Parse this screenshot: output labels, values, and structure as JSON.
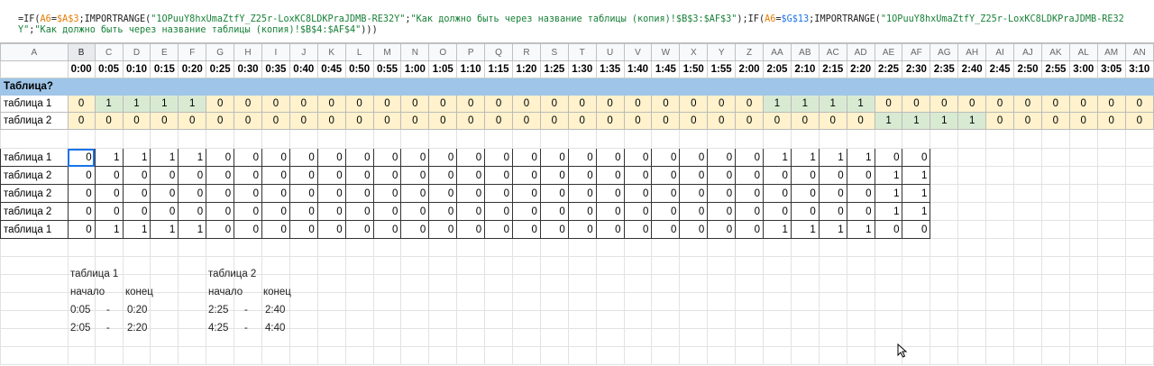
{
  "formula": {
    "p1": "=IF(",
    "r1": "A6",
    "p2": "=",
    "r2": "$A$3",
    "p3": ";IMPORTRANGE(",
    "s1": "\"1OPuuY8hxUmaZtfY_Z25r-LoxKC8LDKPraJDMB-RE32Y\"",
    "p4": ";",
    "s2": "\"Как должно быть через название таблицы (копия)!$B$3:$AF$3\"",
    "p5": ");IF(",
    "r3": "A6",
    "p6": "=",
    "r4": "$G$13",
    "p7": ";IMPORTRANGE(",
    "s3": "\"1OPuuY8hxUmaZtfY_Z25r-LoxKC8LDKPraJDMB-RE32Y\"",
    "p8": ";",
    "s4": "\"Как должно быть через название таблицы (копия)!$B$4:$AF$4\"",
    "p9": ")))"
  },
  "colors": {
    "header_blue": "#9fc5e8",
    "zero_yellow": "#fff2cc",
    "one_green": "#d9ead3",
    "selection": "#1a73e8"
  },
  "grid": {
    "columns": [
      "A",
      "B",
      "C",
      "D",
      "E",
      "F",
      "G",
      "H",
      "I",
      "J",
      "K",
      "L",
      "M",
      "N",
      "O",
      "P",
      "Q",
      "R",
      "S",
      "T",
      "U",
      "V",
      "W",
      "X",
      "Y",
      "Z",
      "AA",
      "AB",
      "AC",
      "AD",
      "AE",
      "AF",
      "AG",
      "AH",
      "AI",
      "AJ",
      "AK",
      "AL",
      "AM",
      "AN"
    ],
    "times": [
      "0:00",
      "0:05",
      "0:10",
      "0:15",
      "0:20",
      "0:25",
      "0:30",
      "0:35",
      "0:40",
      "0:45",
      "0:50",
      "0:55",
      "1:00",
      "1:05",
      "1:10",
      "1:15",
      "1:20",
      "1:25",
      "1:30",
      "1:35",
      "1:40",
      "1:45",
      "1:50",
      "1:55",
      "2:00",
      "2:05",
      "2:10",
      "2:15",
      "2:20",
      "2:25",
      "2:30",
      "2:35",
      "2:40",
      "2:45",
      "2:50",
      "2:55",
      "3:00",
      "3:05",
      "3:10"
    ],
    "section_label": "Таблица?",
    "table_rows": [
      {
        "label": "таблица 1",
        "values": [
          "0",
          "1",
          "1",
          "1",
          "1",
          "0",
          "0",
          "0",
          "0",
          "0",
          "0",
          "0",
          "0",
          "0",
          "0",
          "0",
          "0",
          "0",
          "0",
          "0",
          "0",
          "0",
          "0",
          "0",
          "0",
          "1",
          "1",
          "1",
          "1",
          "0",
          "0",
          "0",
          "0",
          "0",
          "0",
          "0",
          "0",
          "0",
          "0"
        ]
      },
      {
        "label": "таблица 2",
        "values": [
          "0",
          "0",
          "0",
          "0",
          "0",
          "0",
          "0",
          "0",
          "0",
          "0",
          "0",
          "0",
          "0",
          "0",
          "0",
          "0",
          "0",
          "0",
          "0",
          "0",
          "0",
          "0",
          "0",
          "0",
          "0",
          "0",
          "0",
          "0",
          "0",
          "1",
          "1",
          "1",
          "1",
          "0",
          "0",
          "0",
          "0",
          "0",
          "0"
        ]
      }
    ],
    "body_rows": [
      {
        "label": "таблица 1",
        "values": [
          "0",
          "1",
          "1",
          "1",
          "1",
          "0",
          "0",
          "0",
          "0",
          "0",
          "0",
          "0",
          "0",
          "0",
          "0",
          "0",
          "0",
          "0",
          "0",
          "0",
          "0",
          "0",
          "0",
          "0",
          "0",
          "1",
          "1",
          "1",
          "1",
          "0",
          "0"
        ]
      },
      {
        "label": "таблица 2",
        "values": [
          "0",
          "0",
          "0",
          "0",
          "0",
          "0",
          "0",
          "0",
          "0",
          "0",
          "0",
          "0",
          "0",
          "0",
          "0",
          "0",
          "0",
          "0",
          "0",
          "0",
          "0",
          "0",
          "0",
          "0",
          "0",
          "0",
          "0",
          "0",
          "0",
          "1",
          "1"
        ]
      },
      {
        "label": "таблица 2",
        "values": [
          "0",
          "0",
          "0",
          "0",
          "0",
          "0",
          "0",
          "0",
          "0",
          "0",
          "0",
          "0",
          "0",
          "0",
          "0",
          "0",
          "0",
          "0",
          "0",
          "0",
          "0",
          "0",
          "0",
          "0",
          "0",
          "0",
          "0",
          "0",
          "0",
          "1",
          "1"
        ]
      },
      {
        "label": "таблица 2",
        "values": [
          "0",
          "0",
          "0",
          "0",
          "0",
          "0",
          "0",
          "0",
          "0",
          "0",
          "0",
          "0",
          "0",
          "0",
          "0",
          "0",
          "0",
          "0",
          "0",
          "0",
          "0",
          "0",
          "0",
          "0",
          "0",
          "0",
          "0",
          "0",
          "0",
          "1",
          "1"
        ]
      },
      {
        "label": "таблица 1",
        "values": [
          "0",
          "1",
          "1",
          "1",
          "1",
          "0",
          "0",
          "0",
          "0",
          "0",
          "0",
          "0",
          "0",
          "0",
          "0",
          "0",
          "0",
          "0",
          "0",
          "0",
          "0",
          "0",
          "0",
          "0",
          "0",
          "1",
          "1",
          "1",
          "1",
          "0",
          "0"
        ]
      }
    ]
  },
  "notes": {
    "t1": {
      "title": "таблица 1",
      "start": "начало",
      "end": "конец",
      "rows": [
        {
          "start": "0:05",
          "dash": "-",
          "end": "0:20"
        },
        {
          "start": "2:05",
          "dash": "-",
          "end": "2:20"
        }
      ]
    },
    "t2": {
      "title": "таблица 2",
      "start": "начало",
      "end": "конец",
      "rows": [
        {
          "start": "2:25",
          "dash": "-",
          "end": "2:40"
        },
        {
          "start": "4:25",
          "dash": "-",
          "end": "4:40"
        }
      ]
    }
  }
}
